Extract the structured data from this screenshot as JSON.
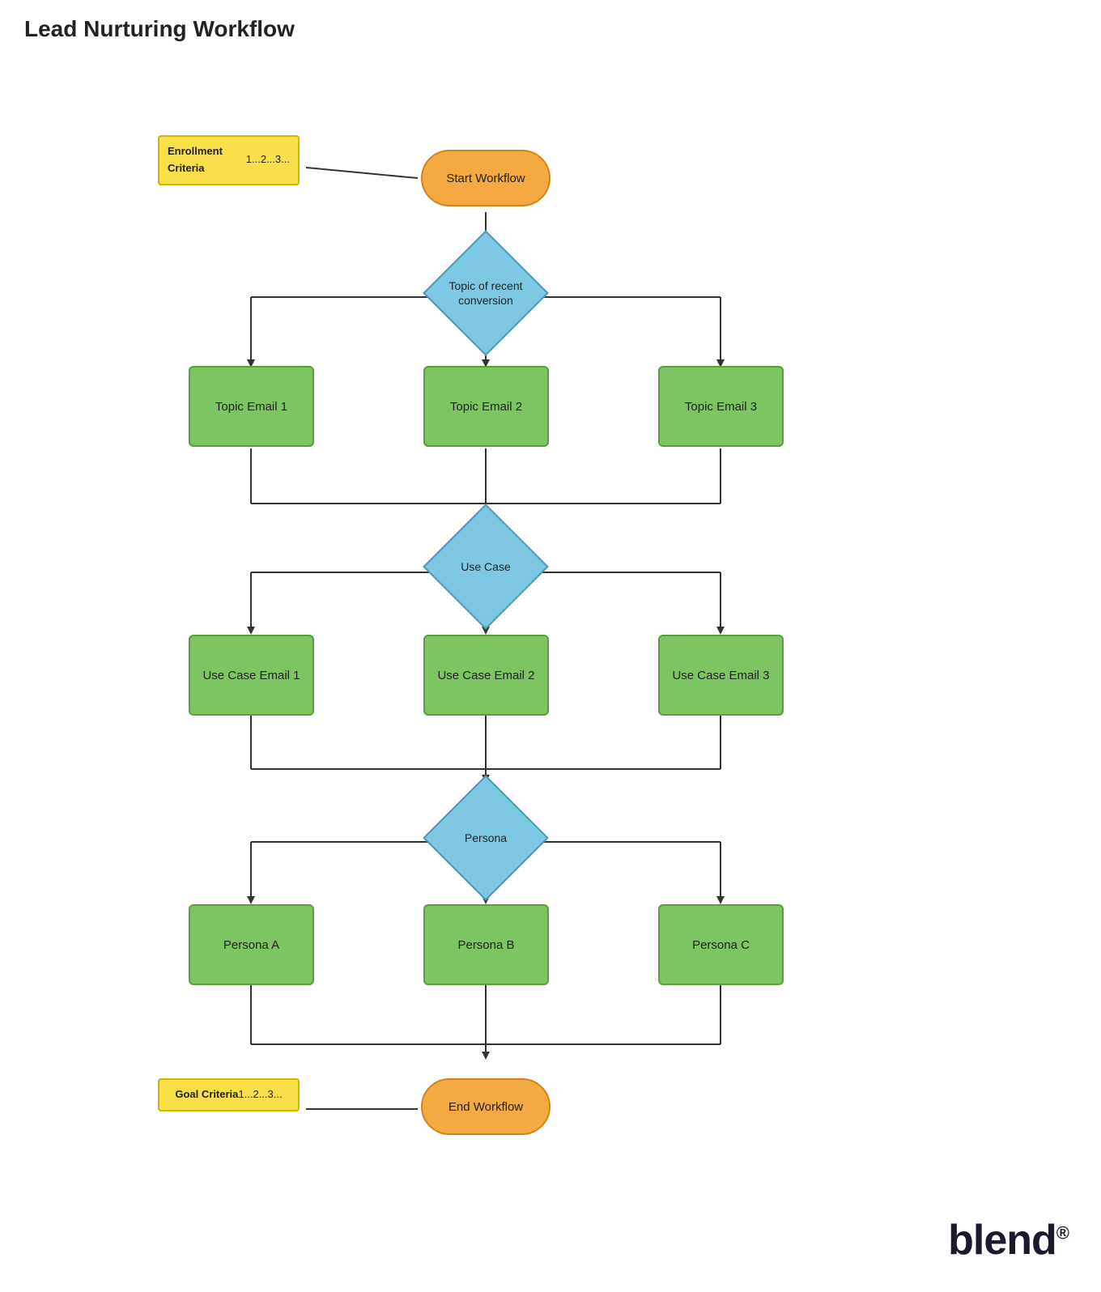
{
  "page": {
    "title": "Lead Nurturing Workflow"
  },
  "nodes": {
    "enrollment_note": {
      "label": "Enrollment Criteria\n1...\n2...\n3...",
      "lines": [
        "Enrollment Criteria",
        "1...",
        "2...",
        "3..."
      ]
    },
    "start_workflow": {
      "label": "Start Workflow"
    },
    "topic_decision": {
      "label": "Topic of recent conversion"
    },
    "topic_email_1": {
      "label": "Topic Email 1"
    },
    "topic_email_2": {
      "label": "Topic Email 2"
    },
    "topic_email_3": {
      "label": "Topic Email 3"
    },
    "use_case_decision": {
      "label": "Use Case"
    },
    "use_case_email_1": {
      "label": "Use Case Email 1"
    },
    "use_case_email_2": {
      "label": "Use Case Email 2"
    },
    "use_case_email_3": {
      "label": "Use Case Email 3"
    },
    "persona_decision": {
      "label": "Persona"
    },
    "persona_a": {
      "label": "Persona A"
    },
    "persona_b": {
      "label": "Persona B"
    },
    "persona_c": {
      "label": "Persona C"
    },
    "goal_note": {
      "label": "Goal Criteria\n1...\n2...\n3...",
      "lines": [
        "Goal Criteria",
        "1...",
        "2...",
        "3..."
      ]
    },
    "end_workflow": {
      "label": "End Workflow"
    }
  },
  "brand": {
    "logo_text": "blend",
    "logo_reg": "®"
  }
}
